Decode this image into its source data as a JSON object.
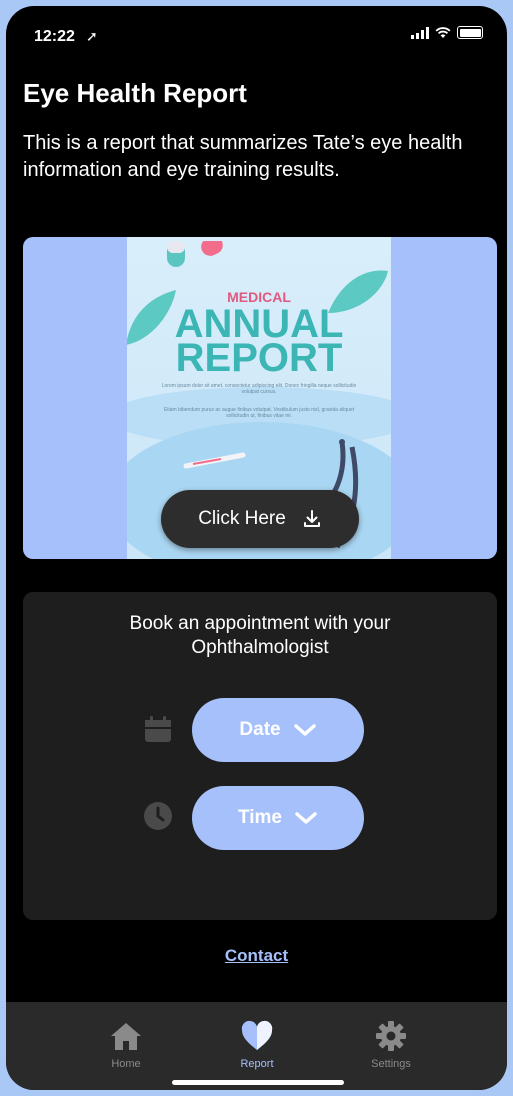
{
  "status_bar": {
    "time": "12:22",
    "location_arrow": "➚"
  },
  "header": {
    "title": "Eye Health Report",
    "description": "This is a report that summarizes Tate’s eye health information and eye training results."
  },
  "report_card": {
    "poster": {
      "kicker": "MEDICAL",
      "title_line1": "ANNUAL",
      "title_line2": "REPORT",
      "body_1": "Lorem ipsum dolor sit amet, consectetur adipiscing elit. Donec fringilla neque sollicitudin volutpat cursus.",
      "body_2": "Etiam bibendum purus ac augue finibus volutpat. Vestibulum justo nisl, gravida aliquet sollicitudin ut, finibus vitae mi."
    },
    "button_label": "Click Here",
    "button_icon": "download-icon"
  },
  "appointment": {
    "title_line1": "Book an appointment with your",
    "title_line2": "Ophthalmologist",
    "date_label": "Date",
    "time_label": "Time"
  },
  "contact_label": "Contact",
  "tabs": [
    {
      "label": "Home",
      "icon": "home-icon",
      "active": false
    },
    {
      "label": "Report",
      "icon": "heart-icon",
      "active": true
    },
    {
      "label": "Settings",
      "icon": "gear-icon",
      "active": false
    }
  ],
  "colors": {
    "accent": "#a6c0fb",
    "background": "#000000",
    "card": "#1e1e1e",
    "tabbar": "#2a2a2a"
  }
}
